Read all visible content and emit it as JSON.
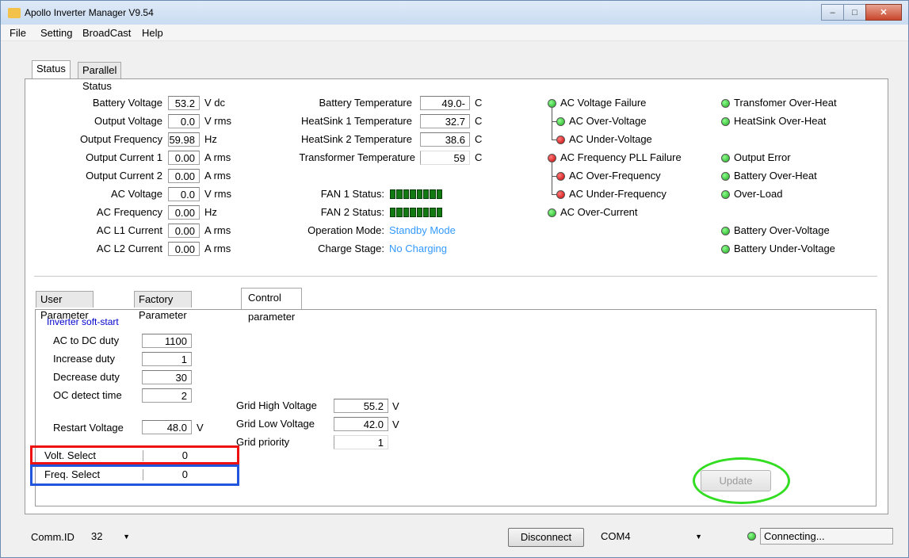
{
  "window": {
    "title": "Apollo Inverter Manager V9.54"
  },
  "menu": [
    "File",
    "Setting",
    "BroadCast",
    "Help"
  ],
  "top_tabs": [
    "Status",
    "Parallel Status"
  ],
  "status_left": [
    {
      "label": "Battery Voltage",
      "value": "53.2",
      "unit": "V dc"
    },
    {
      "label": "Output Voltage",
      "value": "0.0",
      "unit": "V rms"
    },
    {
      "label": "Output Frequency",
      "value": "59.98",
      "unit": "Hz"
    },
    {
      "label": "Output Current 1",
      "value": "0.00",
      "unit": "A rms"
    },
    {
      "label": "Output Current 2",
      "value": "0.00",
      "unit": "A rms"
    },
    {
      "label": "AC Voltage",
      "value": "0.0",
      "unit": "V rms"
    },
    {
      "label": "AC Frequency",
      "value": "0.00",
      "unit": "Hz"
    },
    {
      "label": "AC L1 Current",
      "value": "0.00",
      "unit": "A rms"
    },
    {
      "label": "AC L2 Current",
      "value": "0.00",
      "unit": "A rms"
    }
  ],
  "status_mid": [
    {
      "label": "Battery Temperature",
      "value": "49.0-",
      "unit": "C"
    },
    {
      "label": "HeatSink 1 Temperature",
      "value": "32.7",
      "unit": "C"
    },
    {
      "label": "HeatSink 2 Temperature",
      "value": "38.6",
      "unit": "C"
    },
    {
      "label": "Transformer Temperature",
      "value": "59",
      "unit": "C"
    }
  ],
  "fan1": {
    "label": "FAN 1 Status:"
  },
  "fan2": {
    "label": "FAN 2 Status:"
  },
  "operation_mode": {
    "label": "Operation Mode:",
    "value": "Standby Mode"
  },
  "charge_stage": {
    "label": "Charge Stage:",
    "value": "No Charging"
  },
  "indicators_left": [
    {
      "label": "AC Voltage Failure",
      "state": "green"
    },
    {
      "label": "AC Over-Voltage",
      "state": "green"
    },
    {
      "label": "AC Under-Voltage",
      "state": "red"
    },
    {
      "label": "AC Frequency PLL Failure",
      "state": "red"
    },
    {
      "label": "AC Over-Frequency",
      "state": "red"
    },
    {
      "label": "AC Under-Frequency",
      "state": "red"
    },
    {
      "label": "AC Over-Current",
      "state": "green"
    }
  ],
  "indicators_right": [
    {
      "label": "Transfomer Over-Heat",
      "state": "green"
    },
    {
      "label": "HeatSink Over-Heat",
      "state": "green"
    },
    {
      "label": "Output Error",
      "state": "green"
    },
    {
      "label": "Battery Over-Heat",
      "state": "green"
    },
    {
      "label": "Over-Load",
      "state": "green"
    },
    {
      "label": "Battery Over-Voltage",
      "state": "green"
    },
    {
      "label": "Battery Under-Voltage",
      "state": "green"
    }
  ],
  "bottom_tabs": [
    "User Parameter",
    "Factory Parameter",
    "Control parameter"
  ],
  "control": {
    "section_title": "Inverter soft-start",
    "ac_to_dc_duty": {
      "label": "AC to DC duty",
      "value": "1100"
    },
    "increase_duty": {
      "label": "Increase duty",
      "value": "1"
    },
    "decrease_duty": {
      "label": "Decrease duty",
      "value": "30"
    },
    "oc_detect_time": {
      "label": "OC detect time",
      "value": "2"
    },
    "restart_voltage": {
      "label": "Restart Voltage",
      "value": "48.0",
      "unit": "V"
    },
    "volt_select": {
      "label": "Volt. Select",
      "value": "0"
    },
    "freq_select": {
      "label": "Freq. Select",
      "value": "0"
    },
    "grid_high_voltage": {
      "label": "Grid High Voltage",
      "value": "55.2",
      "unit": "V"
    },
    "grid_low_voltage": {
      "label": "Grid Low Voltage",
      "value": "42.0",
      "unit": "V"
    },
    "grid_priority": {
      "label": "Grid priority",
      "value": "1"
    },
    "update_label": "Update"
  },
  "statusbar": {
    "comm_id_label": "Comm.ID",
    "comm_id_value": "32",
    "disconnect_label": "Disconnect",
    "port_value": "COM4",
    "connection_text": "Connecting..."
  },
  "colors": {
    "accent_blue": "#3399ff",
    "led_green": "#1fa81f",
    "led_red": "#c80000",
    "highlight_red": "#ee1111",
    "highlight_blue": "#2255dd",
    "highlight_green": "#33dd22"
  }
}
